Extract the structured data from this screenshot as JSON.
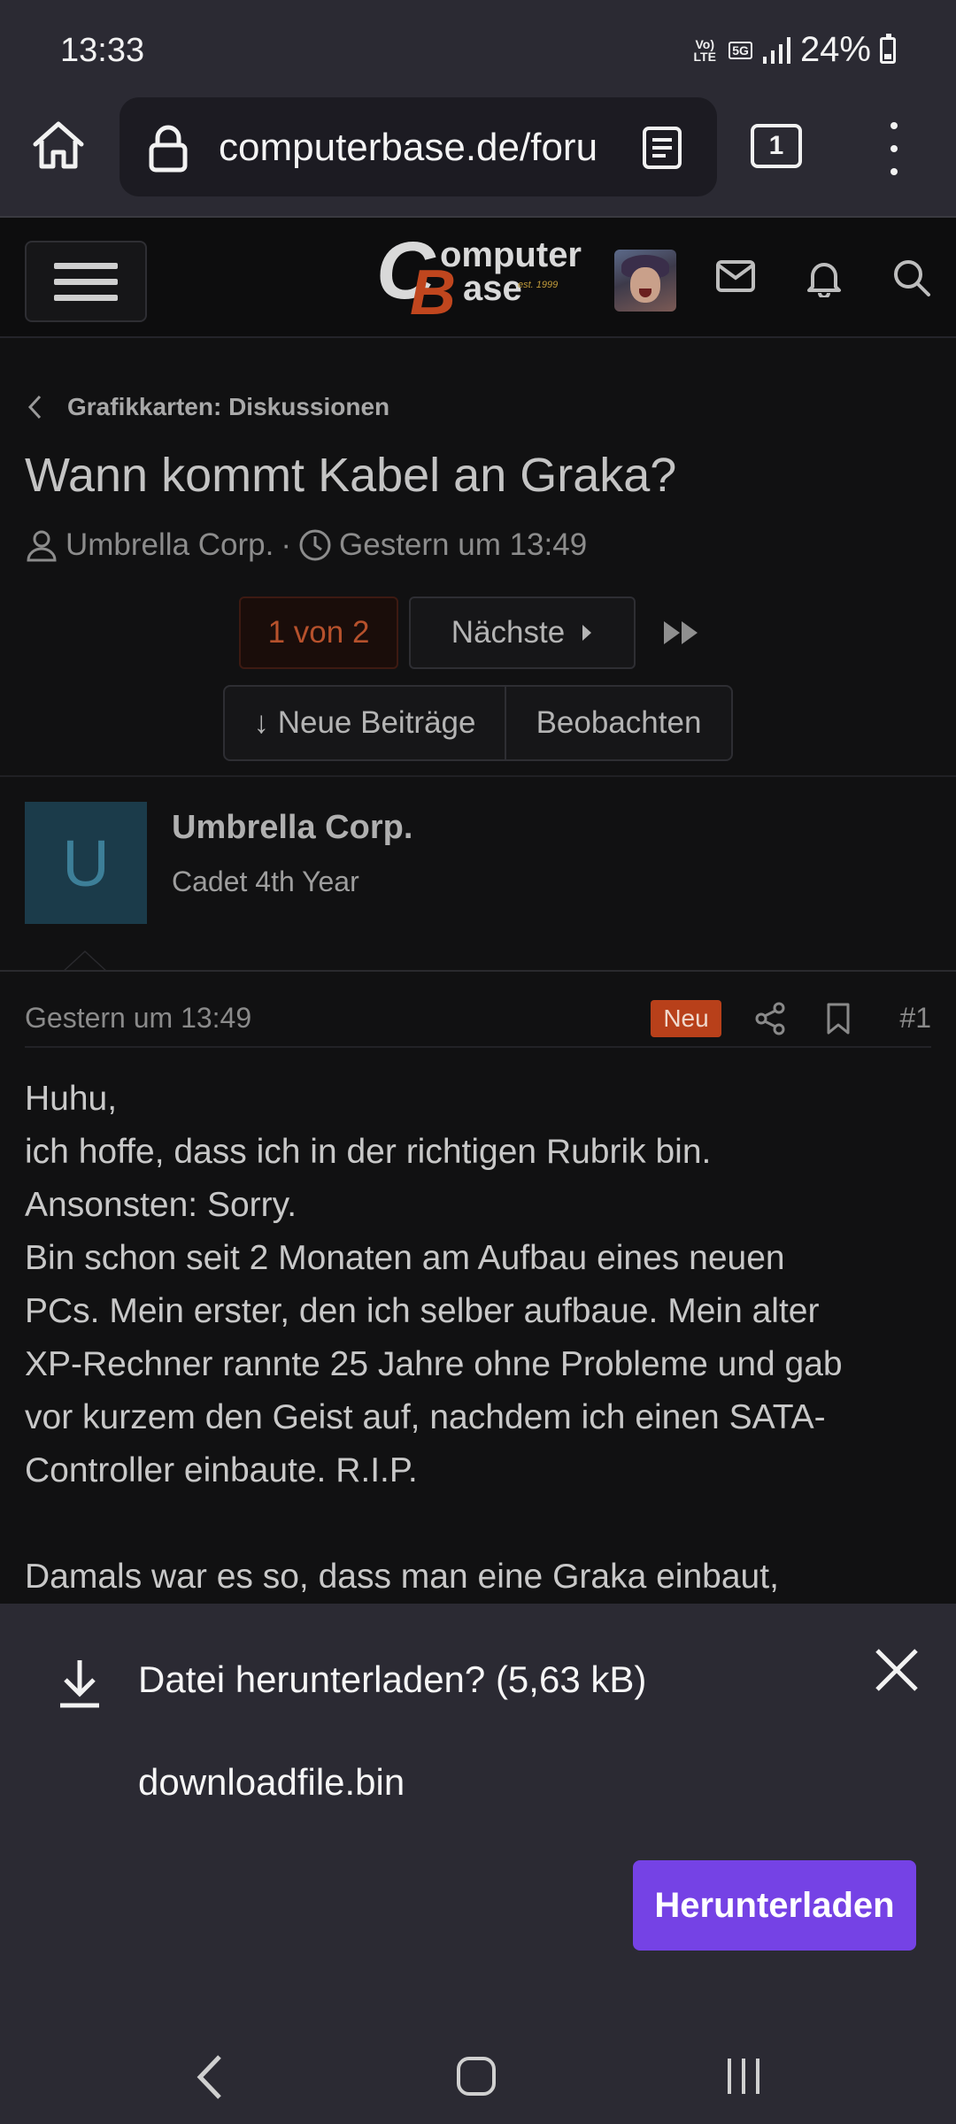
{
  "status_bar": {
    "time": "13:33",
    "network_volte": "Vo) LTE",
    "network_5g": "5G",
    "battery_percent": "24%"
  },
  "browser": {
    "url": "computerbase.de/forum",
    "tab_count": "1"
  },
  "site": {
    "logo_c": "C",
    "logo_b": "B",
    "logo_omputer": "omputer",
    "logo_ase": "ase",
    "logo_est": "est. 1999"
  },
  "thread": {
    "breadcrumb": "Grafikkarten: Diskussionen",
    "title": "Wann kommt Kabel an Graka?",
    "author": "Umbrella Corp.",
    "separator": "·",
    "date": "Gestern um 13:49",
    "pagination": {
      "current": "1 von 2",
      "next": "Nächste"
    },
    "new_posts_label": "↓ Neue Beiträge",
    "watch_label": "Beobachten"
  },
  "post": {
    "avatar_letter": "U",
    "author": "Umbrella Corp.",
    "rank": "Cadet 4th Year",
    "date": "Gestern um 13:49",
    "badge": "Neu",
    "number": "#1",
    "body_p1": "Huhu,\nich hoffe, dass ich in der richtigen Rubrik bin.\nAnsonsten: Sorry.\nBin schon seit 2 Monaten am Aufbau eines neuen\nPCs. Mein erster, den ich selber aufbaue. Mein alter\nXP-Rechner rannte 25 Jahre ohne Probleme und gab\nvor kurzem den Geist auf, nachdem ich einen SATA-\nController einbaute. R.I.P.",
    "body_p2": "Damals war es so, dass man eine Graka einbaut,"
  },
  "download_sheet": {
    "title": "Datei herunterladen? (5,63 kB)",
    "filename": "downloadfile.bin",
    "button_label": "Herunterladen"
  },
  "colors": {
    "accent_orange": "#b8401a",
    "download_button": "#7542e5",
    "chrome_bg": "#2b2a33"
  }
}
